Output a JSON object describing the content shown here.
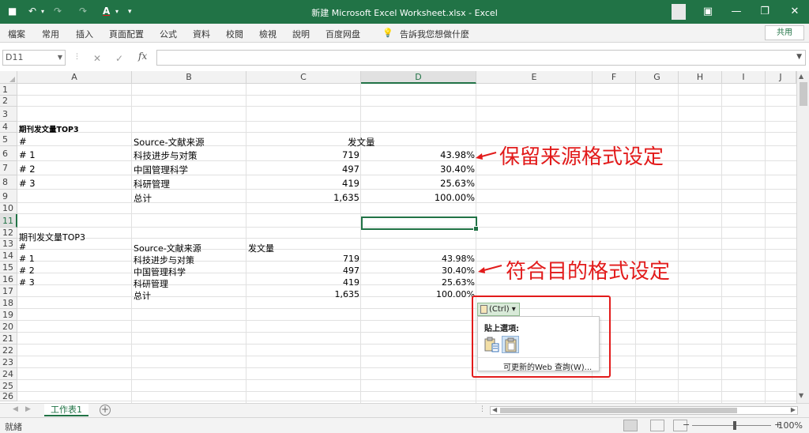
{
  "window": {
    "title": "新建 Microsoft Excel Worksheet.xlsx  -  Excel",
    "qat": {
      "save": "💾",
      "undo": "↶",
      "redo": "↷",
      "font_color": "A",
      "customize": "▾"
    }
  },
  "ribbon": {
    "tabs": [
      "檔案",
      "常用",
      "插入",
      "頁面配置",
      "公式",
      "資料",
      "校閱",
      "檢視",
      "說明",
      "百度网盘"
    ],
    "tell_me": "告訴我您想做什麼",
    "share": "共用"
  },
  "formula_bar": {
    "name_box": "D11",
    "cancel": "✕",
    "enter": "✓",
    "fx": "fx",
    "value": ""
  },
  "columns": [
    "A",
    "B",
    "C",
    "D",
    "E",
    "F",
    "G",
    "H",
    "I",
    "J"
  ],
  "selected_column": "D",
  "selected_row": "11",
  "rows": [
    "1",
    "2",
    "3",
    "4",
    "5",
    "6",
    "7",
    "8",
    "9",
    "10",
    "11",
    "12",
    "13",
    "14",
    "15",
    "16",
    "17",
    "18",
    "19",
    "20",
    "21",
    "22",
    "23",
    "24",
    "25",
    "26"
  ],
  "table1": {
    "title": "期刊发文量TOP3",
    "header": {
      "a": "#",
      "b": "Source-文献来源",
      "c": "发文量"
    },
    "rows": [
      {
        "a": "# 1",
        "b": "科技进步与对策",
        "c": "719",
        "d": "43.98%"
      },
      {
        "a": "# 2",
        "b": "中国管理科学",
        "c": "497",
        "d": "30.40%"
      },
      {
        "a": "# 3",
        "b": "科研管理",
        "c": "419",
        "d": "25.63%"
      }
    ],
    "total": {
      "b": "总计",
      "c": "1,635",
      "d": "100.00%"
    }
  },
  "table2": {
    "title": "期刊发文量TOP3",
    "header": {
      "a": "#",
      "b": "Source-文献来源",
      "c": "发文量"
    },
    "rows": [
      {
        "a": "# 1",
        "b": "科技进步与对策",
        "c": "719",
        "d": "43.98%"
      },
      {
        "a": "# 2",
        "b": "中国管理科学",
        "c": "497",
        "d": "30.40%"
      },
      {
        "a": "# 3",
        "b": "科研管理",
        "c": "419",
        "d": "25.63%"
      }
    ],
    "total": {
      "b": "总计",
      "c": "1,635",
      "d": "100.00%"
    }
  },
  "annotations": {
    "first": "保留来源格式设定",
    "second": "符合目的格式设定",
    "color": "#e21b1b"
  },
  "paste_popup": {
    "tag": "(Ctrl) ▾",
    "header": "貼上選項:",
    "web_query": "可更新的Web 查詢(W)..."
  },
  "sheet": {
    "tab": "工作表1",
    "add": "+"
  },
  "status": {
    "ready": "就緒",
    "zoom": "100%",
    "zoom_minus": "−",
    "zoom_plus": "+"
  },
  "colors": {
    "excel_green": "#217346"
  }
}
